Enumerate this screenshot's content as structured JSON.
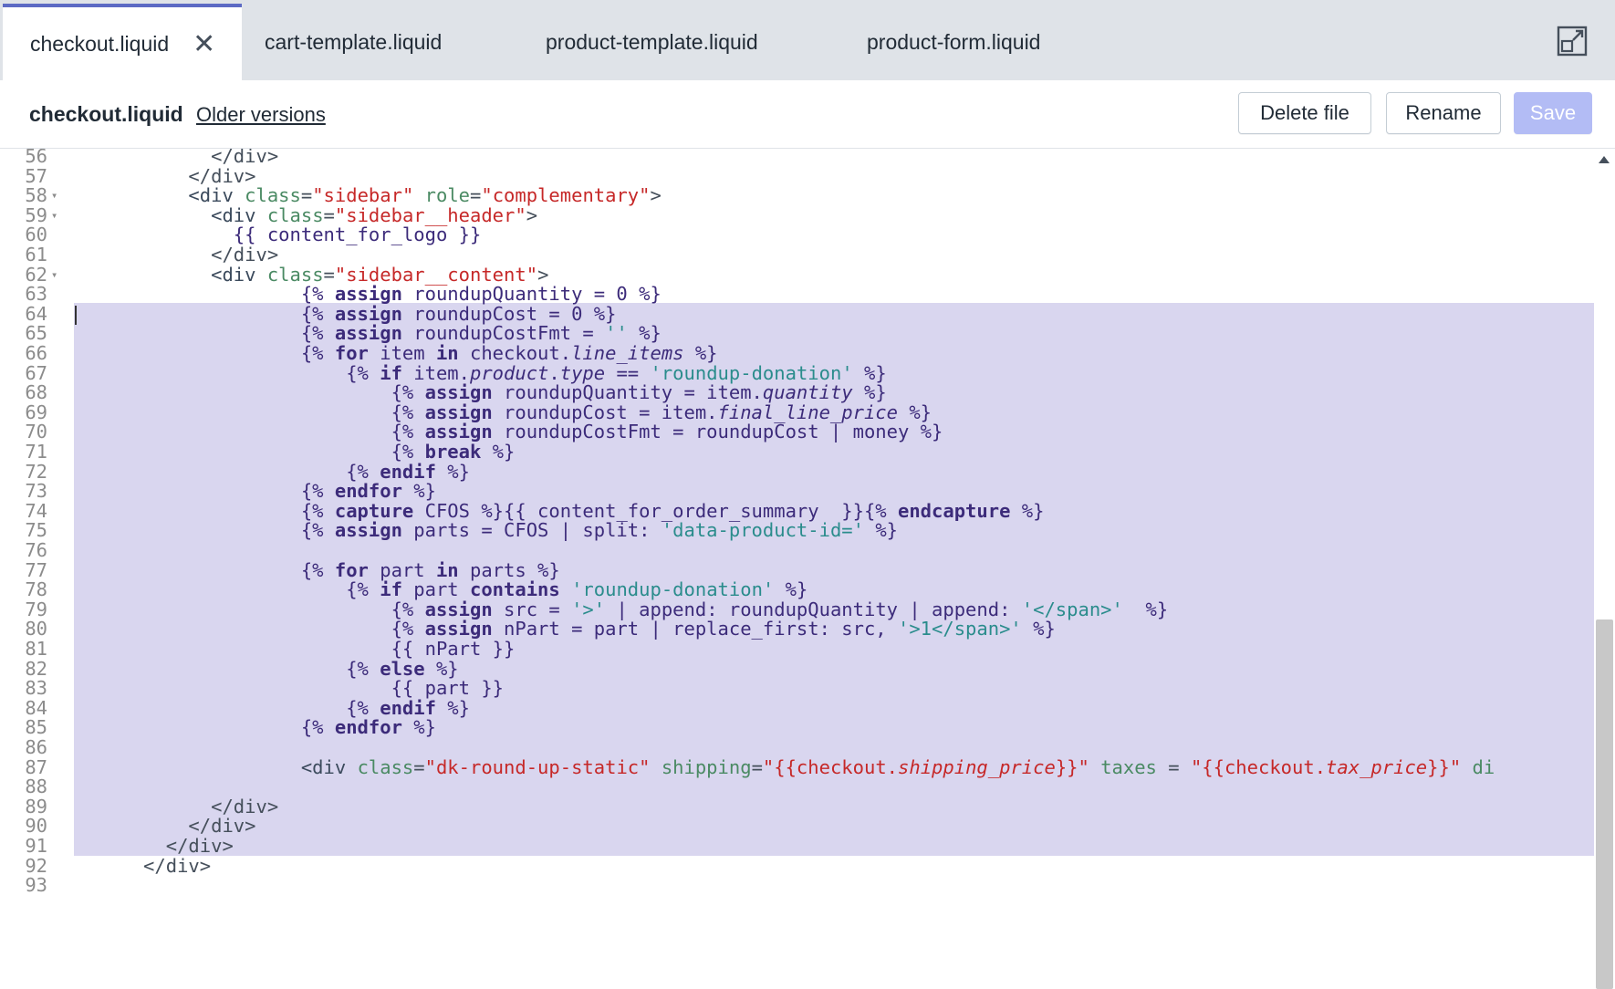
{
  "tabs": [
    {
      "label": "checkout.liquid",
      "active": true
    },
    {
      "label": "cart-template.liquid",
      "active": false
    },
    {
      "label": "product-template.liquid",
      "active": false
    },
    {
      "label": "product-form.liquid",
      "active": false
    }
  ],
  "tab_close_glyph": "✕",
  "toolbar": {
    "file_title": "checkout.liquid",
    "older_versions_link": "Older versions",
    "delete_label": "Delete file",
    "rename_label": "Rename",
    "save_label": "Save"
  },
  "colors": {
    "accent": "#5c6ac4",
    "save_disabled": "#b3bcf5",
    "selection": "#d9d6ef"
  },
  "editor": {
    "selected_lines": [
      63,
      87
    ],
    "lines": [
      {
        "n": "56",
        "fold": false,
        "html": "            &lt;/div&gt;"
      },
      {
        "n": "57",
        "fold": false,
        "html": "          &lt;/div&gt;"
      },
      {
        "n": "58",
        "fold": true,
        "html": "          <span class='t'>&lt;div</span> <span class='a'>class</span>=<span class='s'>\"sidebar\"</span> <span class='a'>role</span>=<span class='s'>\"complementary\"</span>&gt;"
      },
      {
        "n": "59",
        "fold": true,
        "html": "            <span class='t'>&lt;div</span> <span class='a'>class</span>=<span class='s'>\"sidebar__header\"</span>&gt;"
      },
      {
        "n": "60",
        "fold": false,
        "html": "              <span class='lq'>{{ content_for_logo }}</span>"
      },
      {
        "n": "61",
        "fold": false,
        "html": "            &lt;/div&gt;"
      },
      {
        "n": "62",
        "fold": true,
        "html": "            <span class='t'>&lt;div</span> <span class='a'>class</span>=<span class='s'>\"sidebar__content\"</span>&gt;"
      },
      {
        "n": "63",
        "fold": false,
        "html": "                    <span class='lq'>{% <span class='k'>assign</span> roundupQuantity = 0 %}</span>"
      },
      {
        "n": "64",
        "fold": false,
        "html": "                    <span class='lq'>{% <span class='k'>assign</span> roundupCost = 0 %}</span>"
      },
      {
        "n": "65",
        "fold": false,
        "html": "                    <span class='lq'>{% <span class='k'>assign</span> roundupCostFmt = <span class='ls'>''</span> %}</span>"
      },
      {
        "n": "66",
        "fold": false,
        "html": "                    <span class='lq'>{% <span class='k'>for</span> item <span class='k'>in</span> checkout.<span class='i'>line_items</span> %}</span>"
      },
      {
        "n": "67",
        "fold": false,
        "html": "                        <span class='lq'>{% <span class='k'>if</span> item.<span class='i'>product</span>.<span class='i'>type</span> == <span class='ls'>'roundup-donation'</span> %}</span>"
      },
      {
        "n": "68",
        "fold": false,
        "html": "                            <span class='lq'>{% <span class='k'>assign</span> roundupQuantity = item.<span class='i'>quantity</span> %}</span>"
      },
      {
        "n": "69",
        "fold": false,
        "html": "                            <span class='lq'>{% <span class='k'>assign</span> roundupCost = item.<span class='i'>final_line_price</span> %}</span>"
      },
      {
        "n": "70",
        "fold": false,
        "html": "                            <span class='lq'>{% <span class='k'>assign</span> roundupCostFmt = roundupCost | money %}</span>"
      },
      {
        "n": "71",
        "fold": false,
        "html": "                            <span class='lq'>{% <span class='k'>break</span> %}</span>"
      },
      {
        "n": "72",
        "fold": false,
        "html": "                        <span class='lq'>{% <span class='k'>endif</span> %}</span>"
      },
      {
        "n": "73",
        "fold": false,
        "html": "                    <span class='lq'>{% <span class='k'>endfor</span> %}</span>"
      },
      {
        "n": "74",
        "fold": false,
        "html": "                    <span class='lq'>{% <span class='k'>capture</span> CFOS %}{{ content_for_order_summary  }}{% <span class='k'>endcapture</span> %}</span>"
      },
      {
        "n": "75",
        "fold": false,
        "html": "                    <span class='lq'>{% <span class='k'>assign</span> parts = CFOS | split: <span class='ls'>'data-product-id='</span> %}</span>"
      },
      {
        "n": "76",
        "fold": false,
        "html": ""
      },
      {
        "n": "77",
        "fold": false,
        "html": "                    <span class='lq'>{% <span class='k'>for</span> part <span class='k'>in</span> parts %}</span>"
      },
      {
        "n": "78",
        "fold": false,
        "html": "                        <span class='lq'>{% <span class='k'>if</span> part <span class='k'>contains</span> <span class='ls'>'roundup-donation'</span> %}</span>"
      },
      {
        "n": "79",
        "fold": false,
        "html": "                            <span class='lq'>{% <span class='k'>assign</span> src = <span class='ls'>'&gt;'</span> | append: roundupQuantity | append: <span class='ls'>'&lt;/span&gt;'</span>  %}</span>"
      },
      {
        "n": "80",
        "fold": false,
        "html": "                            <span class='lq'>{% <span class='k'>assign</span> nPart = part | replace_first: src, <span class='ls'>'&gt;1&lt;/span&gt;'</span> %}</span>"
      },
      {
        "n": "81",
        "fold": false,
        "html": "                            <span class='lq'>{{ nPart }}</span>"
      },
      {
        "n": "82",
        "fold": false,
        "html": "                        <span class='lq'>{% <span class='k'>else</span> %}</span>"
      },
      {
        "n": "83",
        "fold": false,
        "html": "                            <span class='lq'>{{ part }}</span>"
      },
      {
        "n": "84",
        "fold": false,
        "html": "                        <span class='lq'>{% <span class='k'>endif</span> %}</span>"
      },
      {
        "n": "85",
        "fold": false,
        "html": "                    <span class='lq'>{% <span class='k'>endfor</span> %}</span>"
      },
      {
        "n": "86",
        "fold": false,
        "html": ""
      },
      {
        "n": "87",
        "fold": false,
        "html": "                    <span class='t'>&lt;div</span> <span class='a'>class</span>=<span class='s'>\"dk-round-up-static\"</span> <span class='a'>shipping</span>=<span class='s'>\"{{checkout.<span class='i'>shipping_price</span>}}\"</span> <span class='a'>taxes</span> = <span class='s'>\"{{checkout.<span class='i'>tax_price</span>}}\"</span> <span class='a'>di</span>"
      },
      {
        "n": "88",
        "fold": false,
        "html": ""
      },
      {
        "n": "89",
        "fold": false,
        "html": "            &lt;/div&gt;"
      },
      {
        "n": "90",
        "fold": false,
        "html": "          &lt;/div&gt;"
      },
      {
        "n": "91",
        "fold": false,
        "html": "        &lt;/div&gt;"
      },
      {
        "n": "92",
        "fold": false,
        "html": "      &lt;/div&gt;"
      },
      {
        "n": "93",
        "fold": false,
        "html": ""
      }
    ]
  }
}
